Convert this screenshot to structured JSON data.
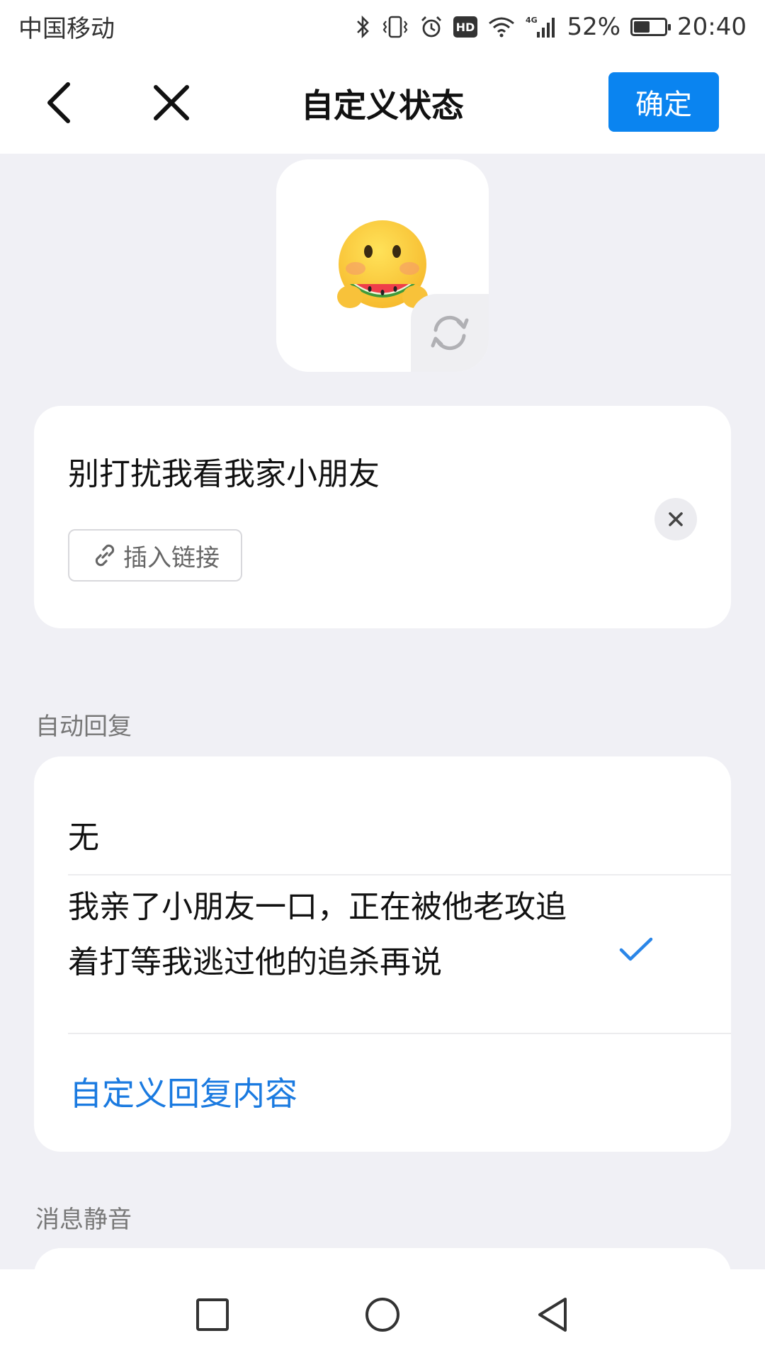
{
  "statusbar": {
    "carrier": "中国移动",
    "hd": "HD",
    "network": "4G",
    "battery_percent_label": "52%",
    "battery_level": 0.52,
    "time": "20:40"
  },
  "header": {
    "title": "自定义状态",
    "confirm_label": "确定"
  },
  "status": {
    "emoji": "face-savoring-watermelon",
    "text": "别打扰我看我家小朋友",
    "insert_link_label": "插入链接"
  },
  "auto_reply": {
    "section_label": "自动回复",
    "options": [
      {
        "label": "无",
        "selected": false
      },
      {
        "label_line1": "我亲了小朋友一口，正在被他老攻追",
        "label_line2": "着打等我逃过他的追杀再说",
        "selected": true
      }
    ],
    "custom_label": "自定义回复内容"
  },
  "mute": {
    "section_label": "消息静音"
  },
  "colors": {
    "accent": "#0a84f0",
    "link_blue": "#1a7ae0",
    "check_blue": "#2a86e8",
    "background": "#f0f0f5"
  },
  "icons": [
    "back-icon",
    "close-icon",
    "refresh-icon",
    "clear-icon",
    "link-icon",
    "check-icon",
    "nav-recents-icon",
    "nav-home-icon",
    "nav-back-icon"
  ]
}
